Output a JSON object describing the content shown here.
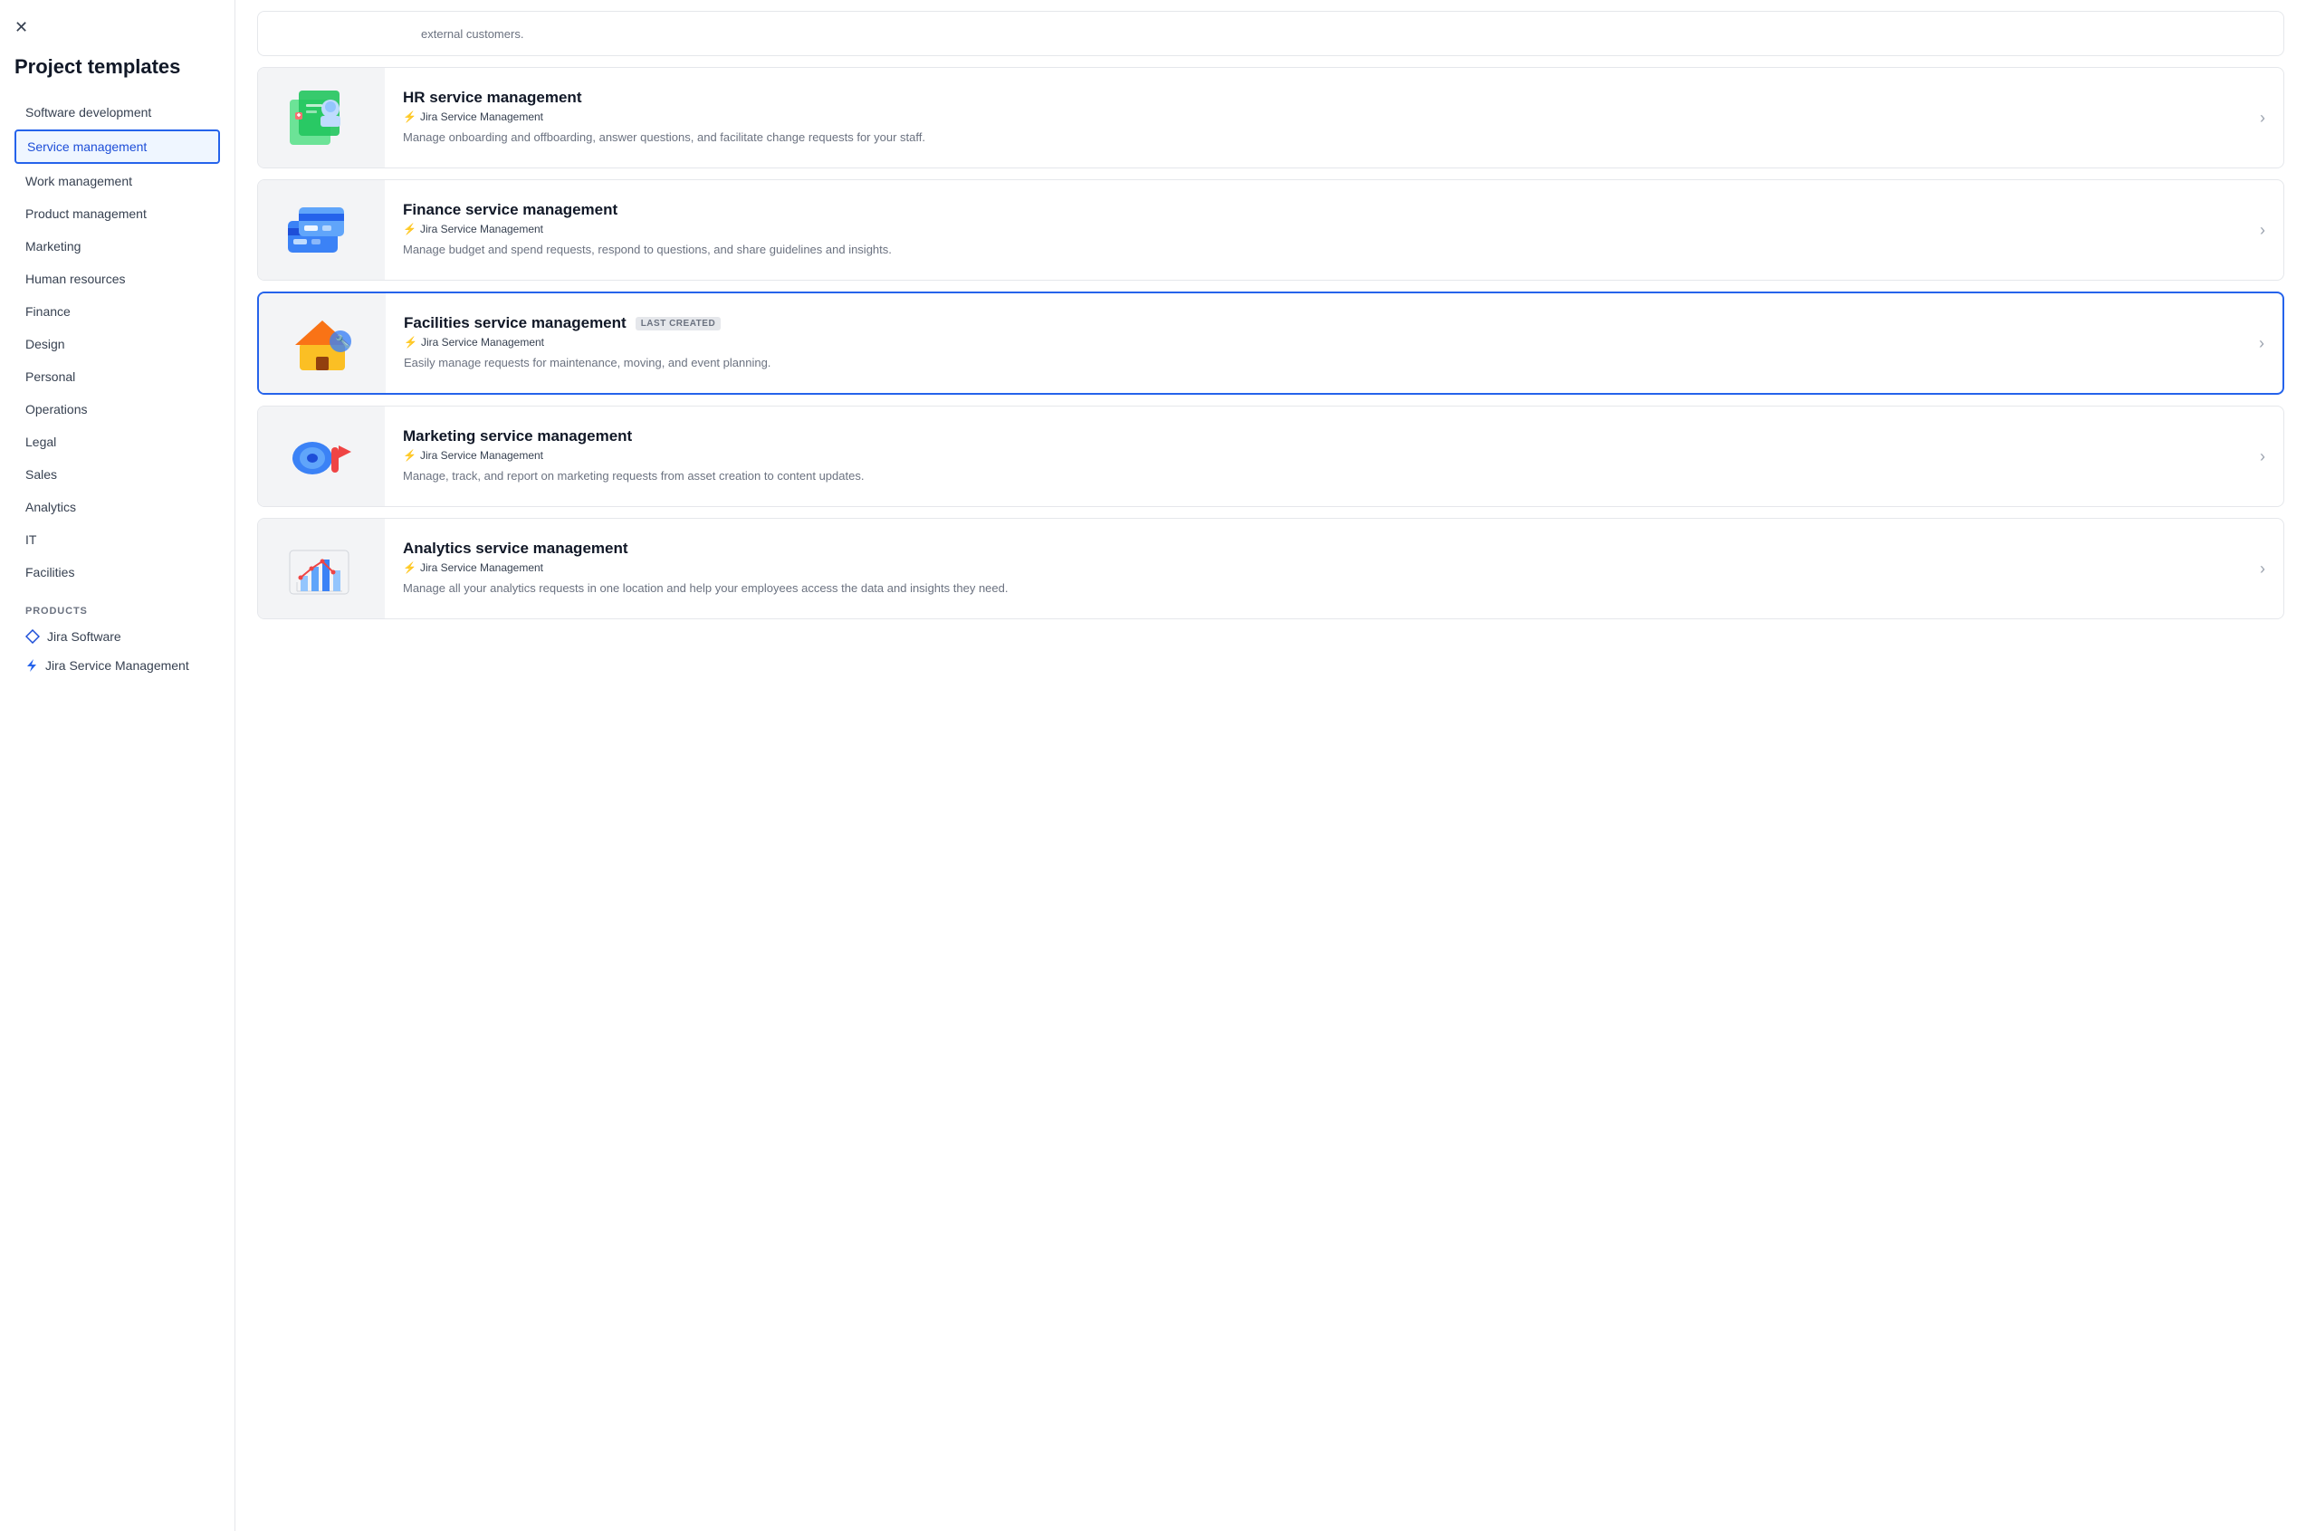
{
  "sidebar": {
    "title": "Project templates",
    "close_label": "×",
    "nav_items": [
      {
        "id": "software-development",
        "label": "Software development",
        "active": false
      },
      {
        "id": "service-management",
        "label": "Service management",
        "active": true
      },
      {
        "id": "work-management",
        "label": "Work management",
        "active": false
      },
      {
        "id": "product-management",
        "label": "Product management",
        "active": false
      },
      {
        "id": "marketing",
        "label": "Marketing",
        "active": false
      },
      {
        "id": "human-resources",
        "label": "Human resources",
        "active": false
      },
      {
        "id": "finance",
        "label": "Finance",
        "active": false
      },
      {
        "id": "design",
        "label": "Design",
        "active": false
      },
      {
        "id": "personal",
        "label": "Personal",
        "active": false
      },
      {
        "id": "operations",
        "label": "Operations",
        "active": false
      },
      {
        "id": "legal",
        "label": "Legal",
        "active": false
      },
      {
        "id": "sales",
        "label": "Sales",
        "active": false
      },
      {
        "id": "analytics",
        "label": "Analytics",
        "active": false
      },
      {
        "id": "it",
        "label": "IT",
        "active": false
      },
      {
        "id": "facilities",
        "label": "Facilities",
        "active": false
      }
    ],
    "products_label": "PRODUCTS",
    "products": [
      {
        "id": "jira-software",
        "label": "Jira Software",
        "icon": "diamond"
      },
      {
        "id": "jira-service-management",
        "label": "Jira Service Management",
        "icon": "bolt"
      }
    ]
  },
  "main": {
    "cards": [
      {
        "id": "hr-service-management",
        "title": "HR service management",
        "badge": null,
        "product": "Jira Service Management",
        "description": "Manage onboarding and offboarding, answer questions, and facilitate change requests for your staff.",
        "highlighted": false,
        "illus": "hr"
      },
      {
        "id": "finance-service-management",
        "title": "Finance service management",
        "badge": null,
        "product": "Jira Service Management",
        "description": "Manage budget and spend requests, respond to questions, and share guidelines and insights.",
        "highlighted": false,
        "illus": "finance"
      },
      {
        "id": "facilities-service-management",
        "title": "Facilities service management",
        "badge": "LAST CREATED",
        "product": "Jira Service Management",
        "description": "Easily manage requests for maintenance, moving, and event planning.",
        "highlighted": true,
        "illus": "facilities"
      },
      {
        "id": "marketing-service-management",
        "title": "Marketing service management",
        "badge": null,
        "product": "Jira Service Management",
        "description": "Manage, track, and report on marketing requests from asset creation to content updates.",
        "highlighted": false,
        "illus": "marketing"
      },
      {
        "id": "analytics-service-management",
        "title": "Analytics service management",
        "badge": null,
        "product": "Jira Service Management",
        "description": "Manage all your analytics requests in one location and help your employees access the data and insights they need.",
        "highlighted": false,
        "illus": "analytics"
      }
    ]
  }
}
